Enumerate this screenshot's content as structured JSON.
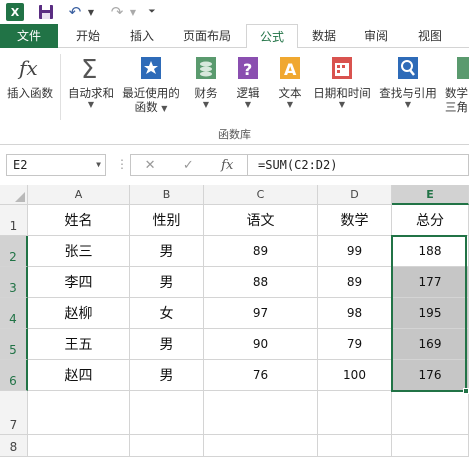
{
  "qat": {
    "logo": "X",
    "save_icon": "save-icon",
    "undo_icon": "undo-icon",
    "redo_icon": "redo-icon"
  },
  "tabs": [
    "文件",
    "开始",
    "插入",
    "页面布局",
    "公式",
    "数据",
    "审阅",
    "视图"
  ],
  "active_tab": "公式",
  "ribbon": {
    "buttons": [
      {
        "label": "插入函数",
        "icon": "function-fx-icon",
        "dropdown": false
      },
      {
        "label": "自动求和",
        "icon": "autosum-sigma-icon",
        "dropdown": true
      },
      {
        "label": "最近使用的\n函数",
        "icon": "star-book-icon",
        "dropdown": true
      },
      {
        "label": "财务",
        "icon": "finance-book-icon",
        "dropdown": true
      },
      {
        "label": "逻辑",
        "icon": "logical-question-icon",
        "dropdown": true
      },
      {
        "label": "文本",
        "icon": "text-a-icon",
        "dropdown": true
      },
      {
        "label": "日期和时间",
        "icon": "calendar-clock-icon",
        "dropdown": true
      },
      {
        "label": "查找与引用",
        "icon": "lookup-magnifier-icon",
        "dropdown": true
      },
      {
        "label": "数学\n三角函",
        "icon": "math-trig-icon",
        "dropdown": false
      }
    ],
    "group_label": "函数库"
  },
  "formula_bar": {
    "name_box": "E2",
    "cancel": "✕",
    "enter": "✓",
    "fx": "fx",
    "formula": "=SUM(C2:D2)"
  },
  "columns": [
    "A",
    "B",
    "C",
    "D",
    "E"
  ],
  "selected_column": "E",
  "rows": [
    "1",
    "2",
    "3",
    "4",
    "5",
    "6",
    "7",
    "8"
  ],
  "selected_rows": [
    "2",
    "3",
    "4",
    "5",
    "6"
  ],
  "headers": [
    "姓名",
    "性别",
    "语文",
    "数学",
    "总分"
  ],
  "table": [
    [
      "张三",
      "男",
      "89",
      "99",
      "188"
    ],
    [
      "李四",
      "男",
      "88",
      "89",
      "177"
    ],
    [
      "赵柳",
      "女",
      "97",
      "98",
      "195"
    ],
    [
      "王五",
      "男",
      "90",
      "79",
      "169"
    ],
    [
      "赵四",
      "男",
      "76",
      "100",
      "176"
    ]
  ],
  "colors": {
    "accent": "#217346",
    "highlight": "#c6c6c6"
  }
}
